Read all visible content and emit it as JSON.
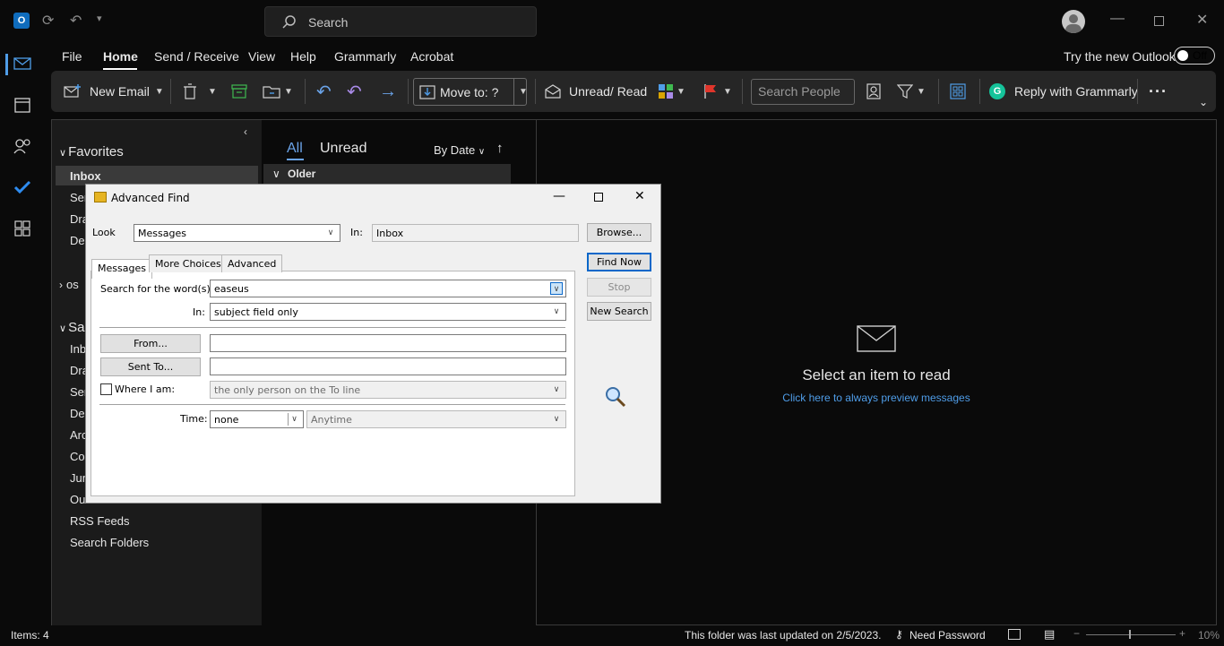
{
  "titlebar": {
    "search_placeholder": "Search"
  },
  "menu": {
    "file": "File",
    "home": "Home",
    "send_receive": "Send / Receive",
    "view": "View",
    "help": "Help",
    "grammarly": "Grammarly",
    "acrobat": "Acrobat",
    "try_new": "Try the new Outlook",
    "toggle": "Off"
  },
  "ribbon": {
    "new_email": "New Email",
    "move_to": "Move to: ?",
    "unread_read": "Unread/ Read",
    "search_people": "Search People",
    "reply_grammarly": "Reply with Grammarly"
  },
  "folders": {
    "favorites": "Favorites",
    "inbox": "Inbox",
    "fav_items": [
      "Ser",
      "Dra",
      "Del"
    ],
    "account": "os",
    "search_hdr": "Sa",
    "account_items": [
      "Inb",
      "Dra",
      "Ser",
      "Del",
      "Arc",
      "Co",
      "Jun",
      "Ou"
    ],
    "rss": "RSS Feeds",
    "search_folders": "Search Folders"
  },
  "list": {
    "tab_all": "All",
    "tab_unread": "Unread",
    "sort": "By Date",
    "group": "Older"
  },
  "reading": {
    "title": "Select an item to read",
    "link": "Click here to always preview messages"
  },
  "status": {
    "items": "Items: 4",
    "updated": "This folder was last updated on 2/5/2023.",
    "need_password": "Need Password",
    "zoom": "10%"
  },
  "dialog": {
    "title": "Advanced Find",
    "look_label": "Look",
    "look_value": "Messages",
    "in_label": "In:",
    "in_value": "Inbox",
    "browse": "Browse...",
    "find_now": "Find Now",
    "stop": "Stop",
    "new_search": "New Search",
    "tabs": [
      "Messages",
      "More Choices",
      "Advanced"
    ],
    "search_words_label": "Search for the word(s):",
    "search_words_value": "easeus",
    "in2_label": "In:",
    "in2_value": "subject field only",
    "from_btn": "From...",
    "sent_to_btn": "Sent To...",
    "where_label": "Where I am:",
    "where_value": "the only person on the To line",
    "time_label": "Time:",
    "time_value": "none",
    "time_range": "Anytime"
  }
}
